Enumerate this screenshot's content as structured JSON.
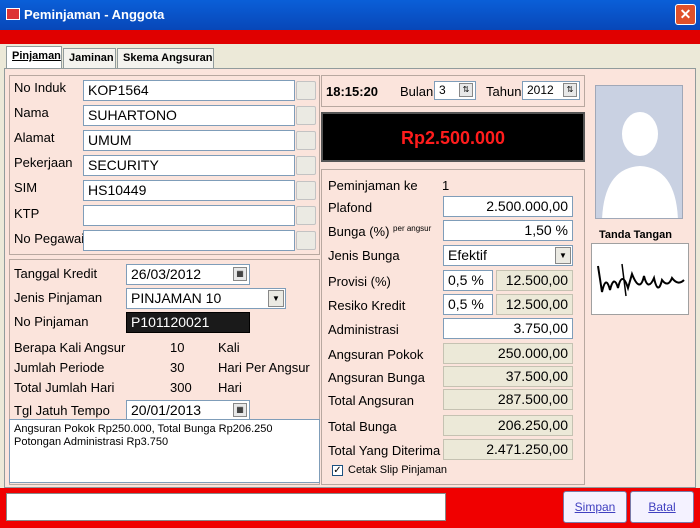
{
  "window": {
    "title": "Peminjaman - Anggota",
    "close_glyph": "✕"
  },
  "tabs": [
    "Pinjaman",
    "Jaminan",
    "Skema Angsuran"
  ],
  "member": {
    "no_induk": {
      "label": "No Induk",
      "value": "KOP1564"
    },
    "nama": {
      "label": "Nama",
      "value": "SUHARTONO"
    },
    "alamat": {
      "label": "Alamat",
      "value": "UMUM"
    },
    "pekerjaan": {
      "label": "Pekerjaan",
      "value": "SECURITY"
    },
    "sim": {
      "label": "SIM",
      "value": "HS10449"
    },
    "ktp": {
      "label": "KTP",
      "value": ""
    },
    "no_pegawai": {
      "label": "No Pegawai",
      "value": ""
    }
  },
  "credit": {
    "tanggal_kredit": {
      "label": "Tanggal Kredit",
      "value": "26/03/2012"
    },
    "jenis_pinjaman": {
      "label": "Jenis Pinjaman",
      "value": "PINJAMAN 10"
    },
    "no_pinjaman": {
      "label": "No Pinjaman",
      "value": "P101120021"
    },
    "berapa_kali": {
      "label": "Berapa Kali Angsur",
      "value": "10",
      "unit": "Kali"
    },
    "jumlah_periode": {
      "label": "Jumlah Periode",
      "value": "30",
      "unit": "Hari Per Angsur"
    },
    "total_hari": {
      "label": "Total Jumlah Hari",
      "value": "300",
      "unit": "Hari"
    },
    "jatuh_tempo": {
      "label": "Tgl Jatuh Tempo",
      "value": "20/01/2013"
    },
    "note_line1": "Angsuran Pokok Rp250.000, Total Bunga Rp206.250",
    "note_line2": "Potongan Administrasi Rp3.750"
  },
  "period": {
    "time": "18:15:20",
    "bulan_label": "Bulan",
    "bulan": "3",
    "tahun_label": "Tahun",
    "tahun": "2012"
  },
  "amount_display": "Rp2.500.000",
  "loan": {
    "ke": {
      "label": "Peminjaman ke",
      "value": "1"
    },
    "plafond": {
      "label": "Plafond",
      "value": "2.500.000,00"
    },
    "bunga": {
      "label": "Bunga (%)",
      "sup": "per angsur",
      "value": "1,50 %"
    },
    "jenis_bunga": {
      "label": "Jenis Bunga",
      "value": "Efektif"
    },
    "provisi": {
      "label": "Provisi (%)",
      "pct": "0,5 %",
      "amount": "12.500,00"
    },
    "resiko": {
      "label": "Resiko Kredit",
      "pct": "0,5 %",
      "amount": "12.500,00"
    },
    "administrasi": {
      "label": "Administrasi",
      "value": "3.750,00"
    },
    "angsuran_pokok": {
      "label": "Angsuran Pokok",
      "value": "250.000,00"
    },
    "angsuran_bunga": {
      "label": "Angsuran Bunga",
      "value": "37.500,00"
    },
    "total_angsuran": {
      "label": "Total Angsuran",
      "value": "287.500,00"
    },
    "total_bunga": {
      "label": "Total Bunga",
      "value": "206.250,00"
    },
    "total_diterima": {
      "label": "Total Yang Diterima",
      "value": "2.471.250,00"
    },
    "cetak_slip": {
      "label": "Cetak Slip Pinjaman",
      "checked": true
    }
  },
  "signature_label": "Tanda Tangan",
  "buttons": {
    "simpan": "Simpan",
    "batal": "Batal"
  },
  "glyphs": {
    "dropdown": "▼",
    "spin": "⇅",
    "calendar": "▦",
    "check": "✓"
  }
}
